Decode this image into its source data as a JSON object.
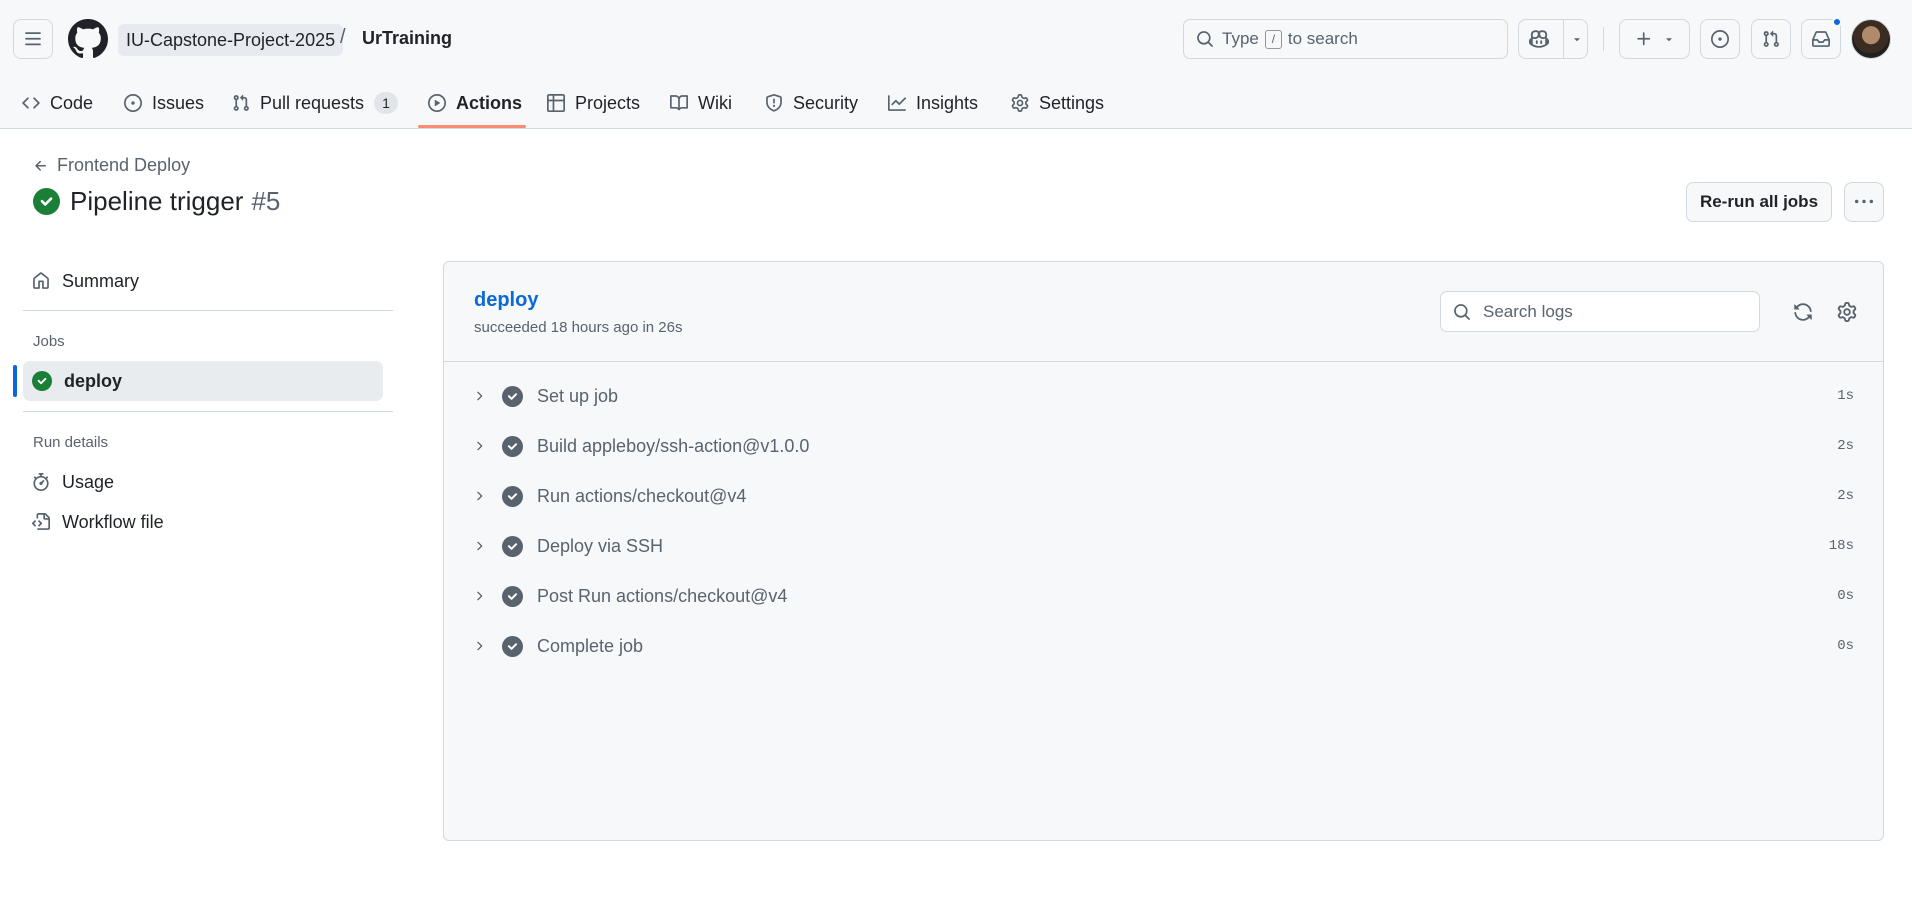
{
  "header": {
    "owner": "IU-Capstone-Project-2025",
    "separator": "/",
    "repo": "UrTraining",
    "search": {
      "prefix": "Type",
      "kbd": "/",
      "suffix": "to search"
    }
  },
  "tabs": [
    {
      "label": "Code",
      "icon": "code-icon"
    },
    {
      "label": "Issues",
      "icon": "issue-icon"
    },
    {
      "label": "Pull requests",
      "icon": "pull-request-icon",
      "count": "1"
    },
    {
      "label": "Actions",
      "icon": "play-icon",
      "selected": true
    },
    {
      "label": "Projects",
      "icon": "table-icon"
    },
    {
      "label": "Wiki",
      "icon": "book-icon"
    },
    {
      "label": "Security",
      "icon": "shield-icon"
    },
    {
      "label": "Insights",
      "icon": "graph-icon"
    },
    {
      "label": "Settings",
      "icon": "gear-icon"
    }
  ],
  "run": {
    "back_label": "Frontend Deploy",
    "title": "Pipeline trigger",
    "number": "#5",
    "status": "success",
    "rerun_label": "Re-run all jobs"
  },
  "sidebar": {
    "summary_label": "Summary",
    "jobs_heading": "Jobs",
    "job_label": "deploy",
    "run_details_heading": "Run details",
    "usage_label": "Usage",
    "workflow_file_label": "Workflow file"
  },
  "job": {
    "name": "deploy",
    "meta": "succeeded 18 hours ago in 26s",
    "search_placeholder": "Search logs",
    "steps": [
      {
        "label": "Set up job",
        "duration": "1s"
      },
      {
        "label": "Build appleboy/ssh-action@v1.0.0",
        "duration": "2s"
      },
      {
        "label": "Run actions/checkout@v4",
        "duration": "2s"
      },
      {
        "label": "Deploy via SSH",
        "duration": "18s"
      },
      {
        "label": "Post Run actions/checkout@v4",
        "duration": "0s"
      },
      {
        "label": "Complete job",
        "duration": "0s"
      }
    ]
  },
  "colors": {
    "accent": "#0969da",
    "success": "#1a7f37",
    "tab_underline": "#fd8c73"
  }
}
